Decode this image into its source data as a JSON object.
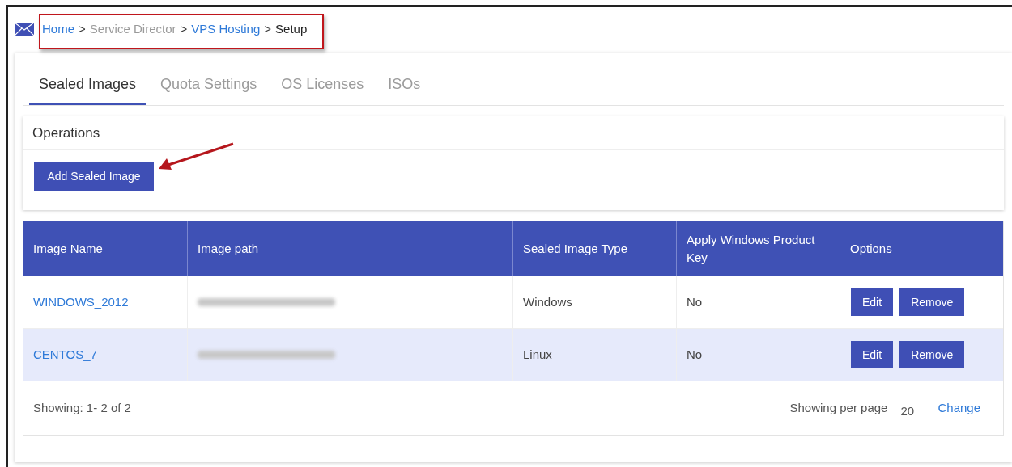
{
  "breadcrumb": [
    {
      "label": "Home",
      "kind": "link"
    },
    {
      "label": "Service Director",
      "kind": "muted"
    },
    {
      "label": "VPS Hosting",
      "kind": "link"
    },
    {
      "label": "Setup",
      "kind": "current"
    }
  ],
  "breadcrumb_separator": ">",
  "tabs": [
    {
      "label": "Sealed Images",
      "selected": true
    },
    {
      "label": "Quota Settings",
      "selected": false
    },
    {
      "label": "OS Licenses",
      "selected": false
    },
    {
      "label": "ISOs",
      "selected": false
    }
  ],
  "operations": {
    "title": "Operations",
    "button": "Add Sealed Image"
  },
  "table": {
    "columns": [
      "Image Name",
      "Image path",
      "Sealed Image Type",
      "Apply Windows Product Key",
      "Options"
    ],
    "rows": [
      {
        "name": "WINDOWS_2012",
        "path_redacted": true,
        "type": "Windows",
        "product_key": "No",
        "actions": [
          "Edit",
          "Remove"
        ],
        "selected": false
      },
      {
        "name": "CENTOS_7",
        "path_redacted": true,
        "type": "Linux",
        "product_key": "No",
        "actions": [
          "Edit",
          "Remove"
        ],
        "selected": true
      }
    ]
  },
  "footer": {
    "showing": "Showing: 1- 2 of 2",
    "per_page_label": "Showing per page",
    "per_page_value": "20",
    "change": "Change"
  }
}
